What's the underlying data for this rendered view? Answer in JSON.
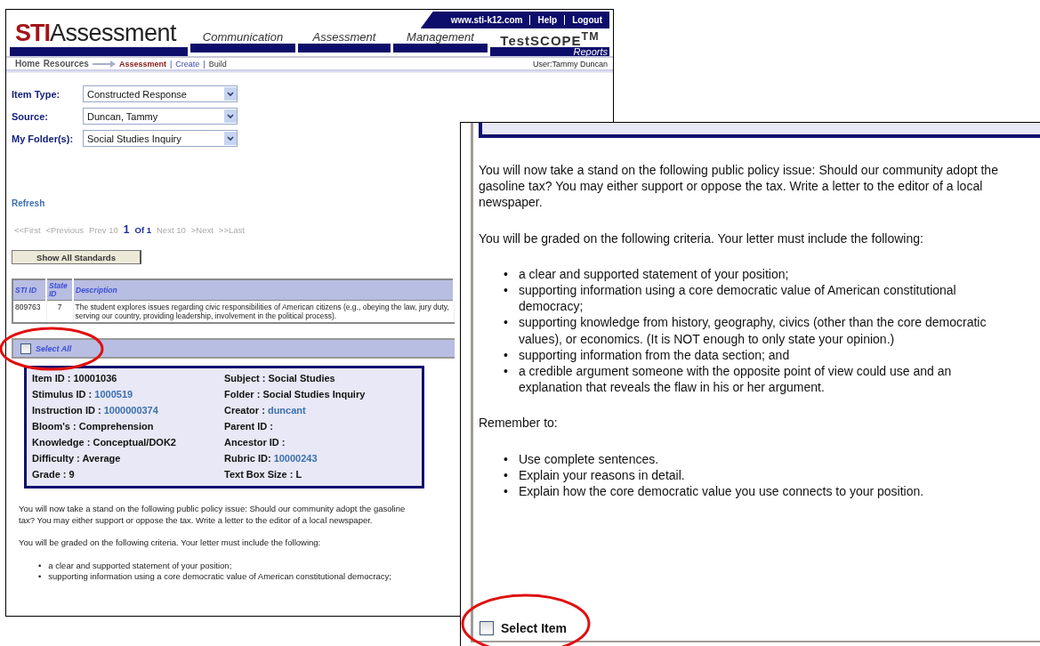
{
  "back_window": {
    "header": {
      "site_links": [
        {
          "label": "www.sti-k12.com"
        },
        {
          "label": "Help"
        },
        {
          "label": "Logout"
        }
      ],
      "logo": {
        "bold_part": "STI",
        "light_part": "Assessment"
      },
      "nav": [
        {
          "label": "Communication",
          "kind": "plain"
        },
        {
          "label": "Assessment",
          "kind": "plain"
        },
        {
          "label": "Management",
          "kind": "plain"
        },
        {
          "label": "TestSCOPE",
          "mark": "TM",
          "sub": "Reports",
          "kind": "brand"
        }
      ]
    },
    "breadcrumb": {
      "items": [
        {
          "label": "Home"
        },
        {
          "label": "Resources"
        }
      ],
      "trail": [
        {
          "label": "Assessment",
          "selected": true,
          "kind": "current"
        },
        {
          "label": "|",
          "kind": "separator"
        },
        {
          "label": "Create",
          "kind": "link"
        },
        {
          "label": "|",
          "kind": "separator"
        },
        {
          "label": "Build",
          "kind": "plain"
        }
      ],
      "user": "User:Tammy Duncan"
    },
    "filters": [
      {
        "label": "Item Type:",
        "value": "Constructed Response"
      },
      {
        "label": "Source:",
        "value": "Duncan, Tammy"
      },
      {
        "label": "My Folder(s):",
        "value": "Social Studies Inquiry"
      }
    ],
    "refresh": "Refresh",
    "pagination": [
      {
        "label": "<<First",
        "kind": "disabled"
      },
      {
        "label": "<Previous",
        "kind": "disabled"
      },
      {
        "label": "Prev 10",
        "kind": "disabled"
      },
      {
        "label": "1",
        "kind": "current"
      },
      {
        "label": "Of 1",
        "kind": "total"
      },
      {
        "label": "Next 10",
        "kind": "disabled"
      },
      {
        "label": ">Next",
        "kind": "disabled"
      },
      {
        "label": ">>Last",
        "kind": "disabled"
      }
    ],
    "show_all_button": "Show All Standards",
    "standards_table": {
      "columns": [
        "STI ID",
        "State ID",
        "Description"
      ],
      "rows": [
        [
          "809763",
          "7",
          "The student explores issues regarding civic responsibilities of American citizens (e.g., obeying the law, jury duty, serving our country, providing leadership, involvement in the political process)."
        ]
      ]
    },
    "select_all": {
      "label": "Select All",
      "checked": false
    },
    "item_card": {
      "left": [
        {
          "label": "Item ID :",
          "value": "10001036",
          "kind": "text"
        },
        {
          "label": "Stimulus ID :",
          "value": "1000519",
          "kind": "link"
        },
        {
          "label": "Instruction ID :",
          "value": "1000000374",
          "kind": "link"
        },
        {
          "label": "Bloom's :",
          "value": "Comprehension",
          "kind": "text"
        },
        {
          "label": "Knowledge :",
          "value": "Conceptual/DOK2",
          "kind": "text"
        },
        {
          "label": "Difficulty :",
          "value": "Average",
          "kind": "text"
        },
        {
          "label": "Grade :",
          "value": "9",
          "kind": "text"
        }
      ],
      "right": [
        {
          "label": "Subject :",
          "value": "Social Studies",
          "kind": "text"
        },
        {
          "label": "Folder :",
          "value": "Social Studies Inquiry",
          "kind": "text"
        },
        {
          "label": "Creator :",
          "value": "duncant",
          "kind": "link"
        },
        {
          "label": "Parent ID :"
        },
        {
          "label": "Ancestor ID :"
        },
        {
          "label": "Rubric ID:",
          "value": "10000243",
          "kind": "link"
        },
        {
          "label": "Text Box Size :",
          "value": "L",
          "kind": "text"
        }
      ]
    },
    "prompt": {
      "marker": "•",
      "paragraphs": [
        "You will now take a stand on the following public policy issue:  Should our community adopt the gasoline tax? You may either support or oppose the tax. Write a letter to the editor of a local newspaper.",
        "You will be graded on the following criteria. Your letter must include the following:"
      ],
      "criteria": [
        "a clear and supported statement of your position;",
        "supporting information using a core democratic value of American constitutional democracy;"
      ]
    }
  },
  "front_window": {
    "marker": "•",
    "paragraphs": [
      "You will now take a stand on the following public policy issue:  Should our community adopt the gasoline tax? You may either support or oppose the tax. Write a letter to the editor of a local newspaper.",
      "You will be graded on the following criteria. Your letter must include the following:"
    ],
    "criteria": [
      "a clear and supported statement of your position;",
      "supporting information using a core democratic value of American constitutional democracy;",
      "supporting knowledge from history, geography, civics (other than the core democratic values), or economics.  (It is NOT enough to only state your opinion.)",
      "supporting information from the data section; and",
      "a credible argument someone with the opposite point of view could use and an explanation that reveals the flaw in his or her argument."
    ],
    "reminder_label": "Remember to:",
    "reminders": [
      "Use complete sentences.",
      "Explain your reasons in detail.",
      "Explain how the core democratic value you use connects to your position."
    ],
    "select_item": {
      "label": "Select Item",
      "checked": false
    }
  }
}
